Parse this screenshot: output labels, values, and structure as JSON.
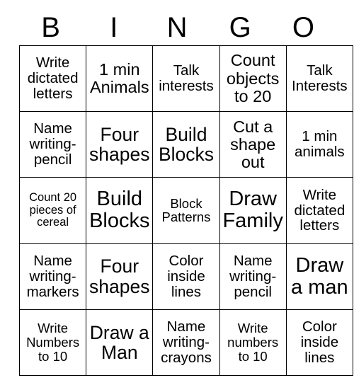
{
  "card": {
    "headers": [
      "B",
      "I",
      "N",
      "G",
      "O"
    ],
    "rows": [
      [
        {
          "text": "Write dictated letters",
          "size": "fs-m"
        },
        {
          "text": "1 min Animals",
          "size": "fs-l"
        },
        {
          "text": "Talk interests",
          "size": "fs-m"
        },
        {
          "text": "Count objects to 20",
          "size": "fs-l"
        },
        {
          "text": "Talk Interests",
          "size": "fs-m"
        }
      ],
      [
        {
          "text": "Name writing-pencil",
          "size": "fs-m"
        },
        {
          "text": "Four shapes",
          "size": "fs-xl"
        },
        {
          "text": "Build Blocks",
          "size": "fs-xl"
        },
        {
          "text": "Cut a shape out",
          "size": "fs-l"
        },
        {
          "text": "1 min animals",
          "size": "fs-m"
        }
      ],
      [
        {
          "text": "Count 20 pieces of cereal",
          "size": "fs-xs"
        },
        {
          "text": "Build Blocks",
          "size": "fs-xxl"
        },
        {
          "text": "Block Patterns",
          "size": "fs-s"
        },
        {
          "text": "Draw Family",
          "size": "fs-xxl"
        },
        {
          "text": "Write dictated letters",
          "size": "fs-m"
        }
      ],
      [
        {
          "text": "Name writing-markers",
          "size": "fs-m"
        },
        {
          "text": "Four shapes",
          "size": "fs-xl"
        },
        {
          "text": "Color inside lines",
          "size": "fs-m"
        },
        {
          "text": "Name writing-pencil",
          "size": "fs-m"
        },
        {
          "text": "Draw a man",
          "size": "fs-xxl"
        }
      ],
      [
        {
          "text": "Write Numbers to 10",
          "size": "fs-s"
        },
        {
          "text": "Draw a Man",
          "size": "fs-xl"
        },
        {
          "text": "Name writing-crayons",
          "size": "fs-m"
        },
        {
          "text": "Write numbers to 10",
          "size": "fs-s"
        },
        {
          "text": "Color inside lines",
          "size": "fs-m"
        }
      ]
    ]
  },
  "colors": {
    "background": "#ffffff",
    "text": "#000000",
    "border": "#000000"
  }
}
